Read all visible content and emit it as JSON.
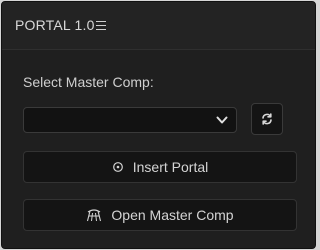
{
  "window": {
    "title": "PORTAL 1.0",
    "menu_icon": "hamburger-menu-icon"
  },
  "form": {
    "select_label": "Select Master Comp:",
    "select_value": "",
    "select_icon": "chevron-down-icon",
    "refresh_icon": "refresh-icon"
  },
  "actions": {
    "insert_label": "Insert Portal",
    "insert_icon": "target-circle-icon",
    "open_label": "Open Master Comp",
    "open_icon": "portal-arch-icon"
  },
  "colors": {
    "background": "#232323",
    "panel": "#1f1f1f",
    "input_bg": "#141414",
    "text": "#d0d0d0"
  }
}
